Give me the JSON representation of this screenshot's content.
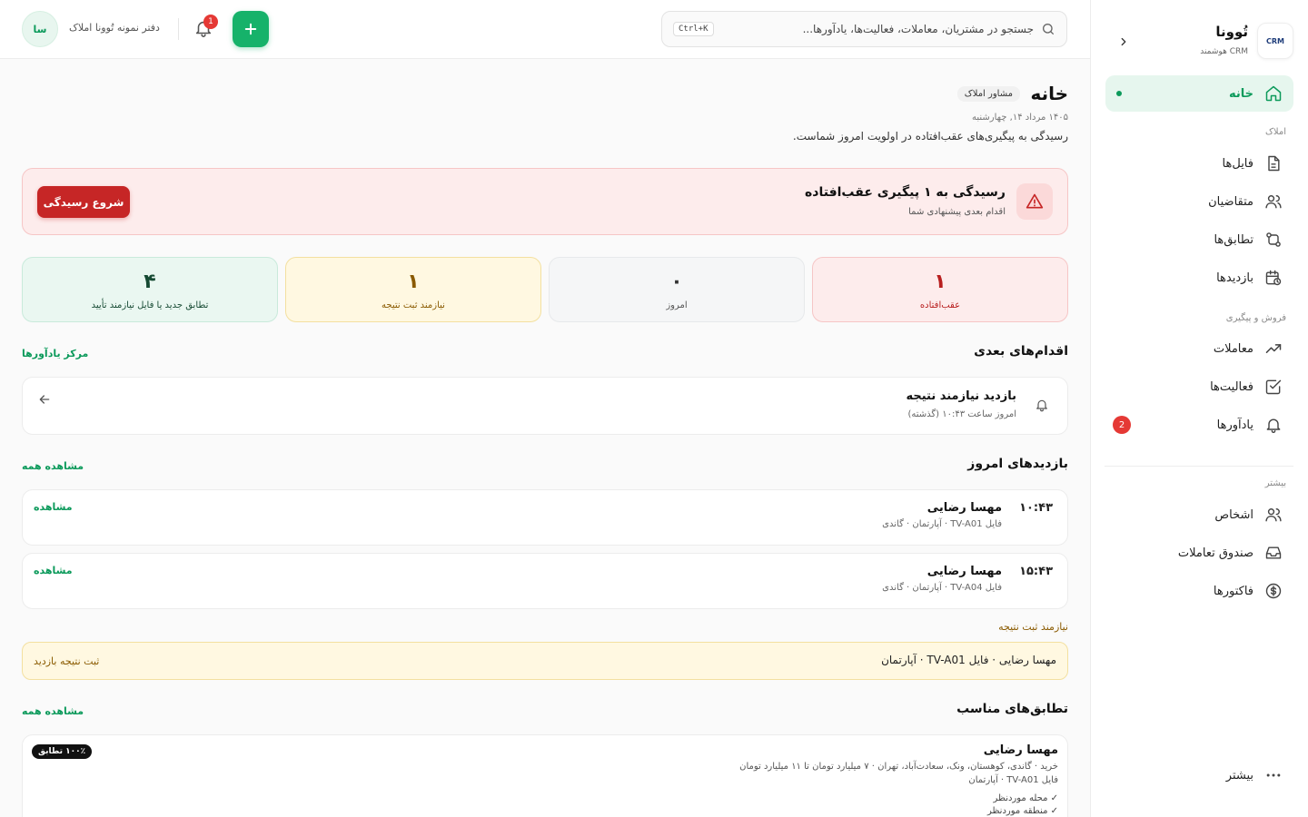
{
  "brand": {
    "logo_text": "CRM",
    "name": "تُوونا",
    "subtitle": "CRM هوشمند"
  },
  "nav": {
    "home": "خانه",
    "section_property": "املاک",
    "files": "فایل‌ها",
    "applicants": "متقاضیان",
    "matches": "تطابق‌ها",
    "visits": "بازدیدها",
    "section_sales": "فروش و پیگیری",
    "deals": "معاملات",
    "activities": "فعالیت‌ها",
    "reminders": "یادآورها",
    "reminders_badge": "2",
    "section_more": "بیشتر",
    "people": "اشخاص",
    "deal_box": "صندوق تعاملات",
    "invoices": "فاکتورها",
    "more": "بیشتر"
  },
  "topbar": {
    "search_placeholder": "جستجو در مشتریان، معاملات، فعالیت‌ها، یادآورها...",
    "shortcut": "Ctrl+K",
    "bell_badge": "1",
    "office_name": "دفتر نمونه تُوونا املاک",
    "avatar_initials": "سا"
  },
  "header": {
    "title": "خانه",
    "role": "مشاور املاک",
    "date": "۱۴۰۵ مرداد ۱۴, چهارشنبه",
    "description": "رسیدگی به پیگیری‌های عقب‌افتاده در اولویت امروز شماست."
  },
  "alert": {
    "title": "رسیدگی به ۱ پیگیری عقب‌افتاده",
    "subtitle": "اقدام بعدی پیشنهادی شما",
    "button": "شروع رسیدگی"
  },
  "stats": {
    "overdue": {
      "value": "۱",
      "label": "عقب‌افتاده"
    },
    "today": {
      "value": "۰",
      "label": "امروز"
    },
    "needs_result": {
      "value": "۱",
      "label": "نیازمند ثبت نتیجه"
    },
    "new_matches": {
      "value": "۴",
      "label": "تطابق جدید یا فایل نیازمند تأیید"
    }
  },
  "next_actions": {
    "title": "اقدام‌های بعدی",
    "link": "مرکز یادآورها",
    "item_title": "بازدید نیازمند نتیجه",
    "item_sub": "امروز ساعت ۱۰:۴۳ (گذشته)"
  },
  "today_visits": {
    "title": "بازدیدهای امروز",
    "link": "مشاهده همه",
    "items": [
      {
        "time": "۱۰:۴۳",
        "name": "مهسا رضایی",
        "sub": "فایل TV-A01 · آپارتمان · گاندی",
        "action": "مشاهده"
      },
      {
        "time": "۱۵:۴۳",
        "name": "مهسا رضایی",
        "sub": "فایل TV-A04 · آپارتمان · گاندی",
        "action": "مشاهده"
      }
    ]
  },
  "pending": {
    "label": "نیازمند ثبت نتیجه",
    "text": "مهسا رضایی · فایل TV-A01 · آپارتمان",
    "action": "ثبت نتیجه بازدید"
  },
  "matches": {
    "title": "تطابق‌های مناسب",
    "link": "مشاهده همه",
    "name": "مهسا رضایی",
    "badge": "۱۰۰٪ تطابق",
    "line1": "خرید · گاندی، کوهستان، ونک، سعادت‌آباد، تهران · ۷ میلیارد تومان تا ۱۱ میلیارد تومان",
    "line2": "فایل TV-A01 · آپارتمان",
    "check1": "✓ محله موردنظر",
    "check2": "✓ منطقه موردنظر"
  },
  "colors": {
    "accent": "#16b26a",
    "danger": "#c62626",
    "warning_bg": "#fff8e1"
  }
}
